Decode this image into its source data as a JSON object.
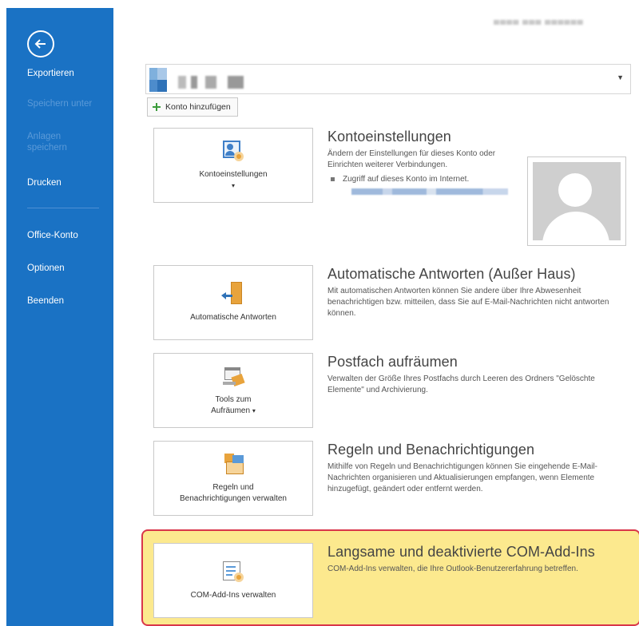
{
  "sidebar": {
    "back_label": "Exportieren",
    "items": [
      {
        "label": "Speichern unter",
        "enabled": false
      },
      {
        "label": "Anlagen speichern",
        "enabled": false
      },
      {
        "label": "Drucken",
        "enabled": true
      },
      {
        "label": "Office-Konto",
        "enabled": true
      },
      {
        "label": "Optionen",
        "enabled": true
      },
      {
        "label": "Beenden",
        "enabled": true
      }
    ]
  },
  "account": {
    "add_account_label": "Konto hinzufügen"
  },
  "sections": [
    {
      "tile_label": "Kontoeinstellungen",
      "tile_caret": "▾",
      "title": "Kontoeinstellungen",
      "description": "Ändern der Einstellungen für dieses Konto oder Einrichten weiterer Verbindungen.",
      "link_text": "Zugriff auf dieses Konto im Internet."
    },
    {
      "tile_label": "Automatische Antworten",
      "title": "Automatische Antworten (Außer Haus)",
      "description": "Mit automatischen Antworten können Sie andere über Ihre Abwesenheit benachrichtigen bzw. mitteilen, dass Sie auf E-Mail-Nachrichten nicht antworten können."
    },
    {
      "tile_label_line1": "Tools zum",
      "tile_label_line2": "Aufräumen",
      "tile_caret": "▾",
      "title": "Postfach aufräumen",
      "description": "Verwalten der Größe Ihres Postfachs durch Leeren des Ordners \"Gelöschte Elemente\" und Archivierung."
    },
    {
      "tile_label_line1": "Regeln und",
      "tile_label_line2": "Benachrichtigungen verwalten",
      "title": "Regeln und Benachrichtigungen",
      "description": "Mithilfe von Regeln und Benachrichtigungen können Sie eingehende E-Mail-Nachrichten organisieren und Aktualisierungen empfangen, wenn Elemente hinzugefügt, geändert oder entfernt werden."
    },
    {
      "tile_label": "COM-Add-Ins verwalten",
      "title": "Langsame und deaktivierte COM-Add-Ins",
      "description": "COM-Add-Ins verwalten, die Ihre Outlook-Benutzererfahrung betreffen."
    }
  ],
  "colors": {
    "sidebar_bg": "#1a72c4",
    "highlight_bg": "#fce98e",
    "highlight_border": "#d9364a",
    "accent_orange": "#e8a33c"
  }
}
